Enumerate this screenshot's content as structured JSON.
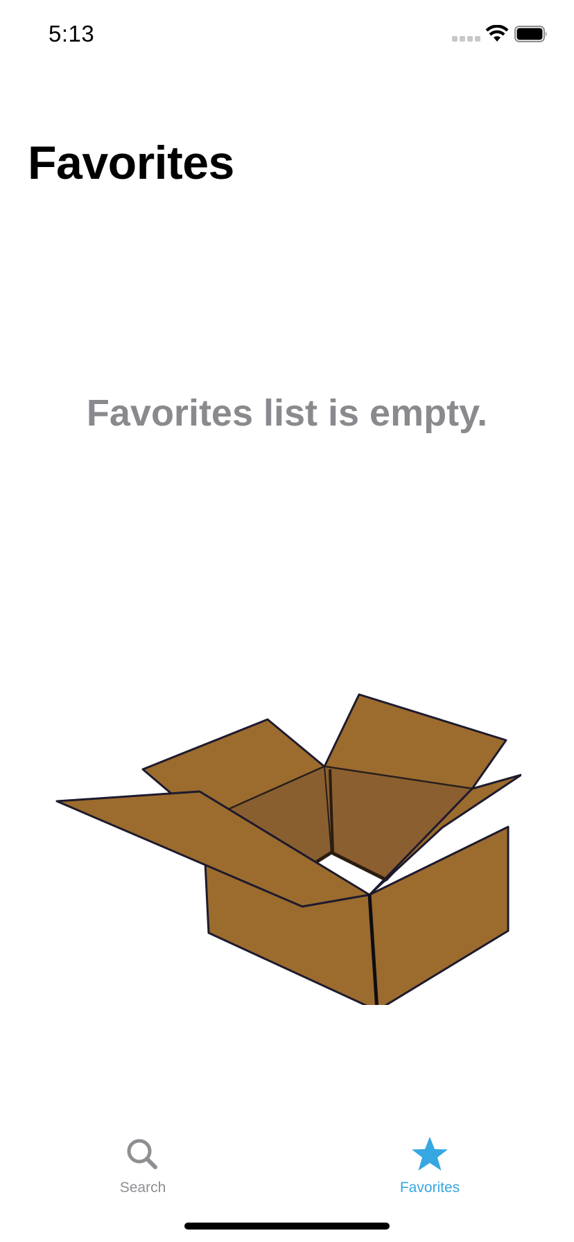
{
  "status_bar": {
    "time": "5:13"
  },
  "header": {
    "title": "Favorites"
  },
  "main": {
    "empty_message": "Favorites list is empty."
  },
  "tab_bar": {
    "tabs": [
      {
        "label": "Search",
        "icon": "search-icon",
        "selected": false
      },
      {
        "label": "Favorites",
        "icon": "star-icon",
        "selected": true
      }
    ]
  },
  "colors": {
    "accent": "#36a7e1",
    "inactive": "#8e8e93",
    "empty_text": "#8a8a8e",
    "box_fill": "#9c6c2e",
    "box_inner": "#8a5f30"
  }
}
